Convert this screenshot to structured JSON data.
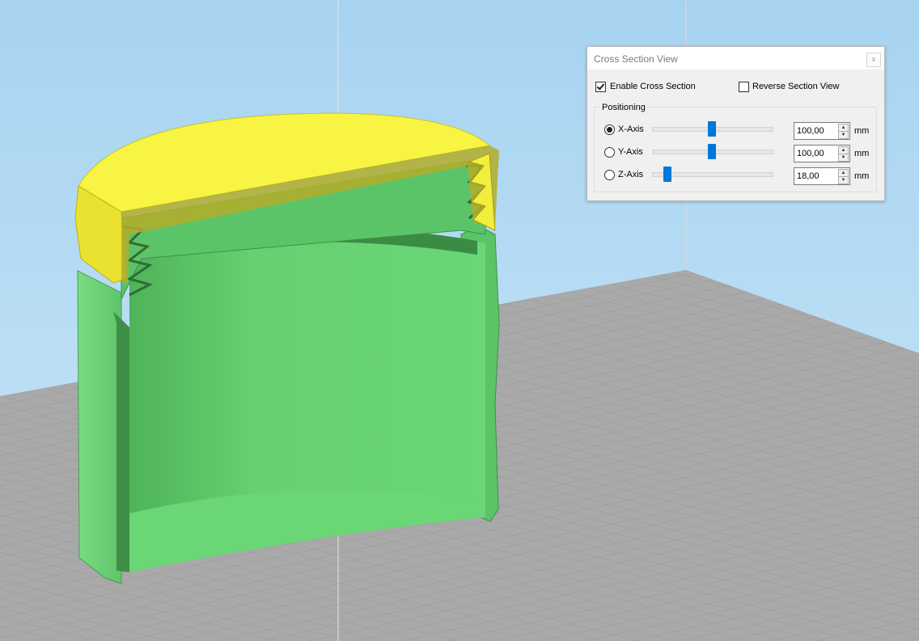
{
  "panel": {
    "title": "Cross Section View",
    "close_label": "x",
    "enable_cross_section": {
      "label": "Enable Cross Section",
      "checked": true
    },
    "reverse_section_view": {
      "label": "Reverse Section View",
      "checked": false
    },
    "positioning": {
      "label": "Positioning",
      "axes": [
        {
          "label": "X-Axis",
          "selected": true,
          "slider": 0.5,
          "value": "100,00",
          "unit": "mm"
        },
        {
          "label": "Y-Axis",
          "selected": false,
          "slider": 0.5,
          "value": "100,00",
          "unit": "mm"
        },
        {
          "label": "Z-Axis",
          "selected": false,
          "slider": 0.12,
          "value": "18,00",
          "unit": "mm"
        }
      ]
    }
  },
  "scene": {
    "sky_color": "#b4d9f0",
    "bed_color": "#a8a8a8",
    "bed_grid_color": "#8e8e8e",
    "model_body_color": "#66d070",
    "model_dark_color": "#3f8f48",
    "cap_color": "#f5f04a"
  }
}
